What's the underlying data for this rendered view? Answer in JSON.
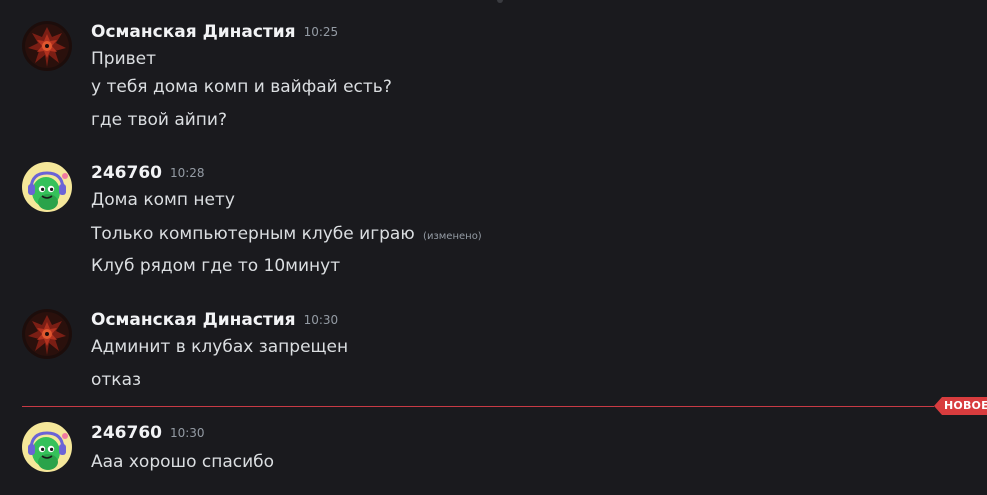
{
  "messages": [
    {
      "author": "Османская Династия",
      "time": "10:25",
      "avatar_icon": "dark-red-ornament-avatar",
      "lines": [
        {
          "text": "Привет"
        },
        {
          "text": "у тебя дома комп и вайфай есть?"
        },
        {
          "text": "где твой айпи?"
        }
      ]
    },
    {
      "author": "246760",
      "time": "10:28",
      "avatar_icon": "green-creature-headphones-avatar",
      "lines": [
        {
          "text": "Дома комп нету"
        },
        {
          "text": "Только компьютерным клубе играю",
          "edited": "(изменено)"
        },
        {
          "text": "Клуб рядом где то 10минут"
        }
      ]
    },
    {
      "author": "Османская Династия",
      "time": "10:30",
      "avatar_icon": "dark-red-ornament-avatar",
      "lines": [
        {
          "text": "Админит в клубах запрещен"
        },
        {
          "text": "отказ"
        }
      ]
    },
    {
      "author": "246760",
      "time": "10:30",
      "avatar_icon": "green-creature-headphones-avatar",
      "lines": [
        {
          "text": "Ааа хорошо спасибо"
        }
      ]
    }
  ],
  "new_divider": {
    "label": "НОВОЕ",
    "color": "#d83c3e"
  },
  "colors": {
    "background": "#1a1a1e",
    "author": "#f2f3f5",
    "text": "#dbdee1",
    "muted": "#949ba4"
  }
}
